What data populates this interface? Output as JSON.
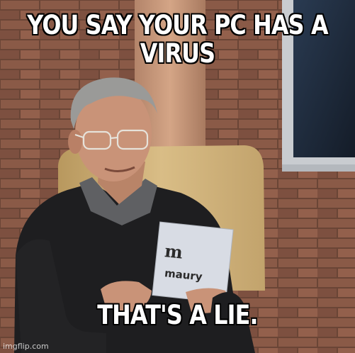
{
  "meme": {
    "top_text": "YOU SAY YOUR PC HAS A VIRUS",
    "bottom_text": "THAT'S A LIE.",
    "card_text": "maury",
    "watermark": "imgflip.com"
  },
  "colors": {
    "brick": "#8a5a47",
    "mortar": "#6a4536",
    "window_frame": "#c9ccd0",
    "window_glass": "#1c2a3c",
    "pillar": "#c39274",
    "chair": "#cfb27a",
    "sweater": "#1e1e20",
    "collar": "#5f6063",
    "skin": "#c99378",
    "hair": "#9a9a98",
    "card": "#d8dce4",
    "caption_text": "#ffffff",
    "caption_outline": "#000000"
  }
}
